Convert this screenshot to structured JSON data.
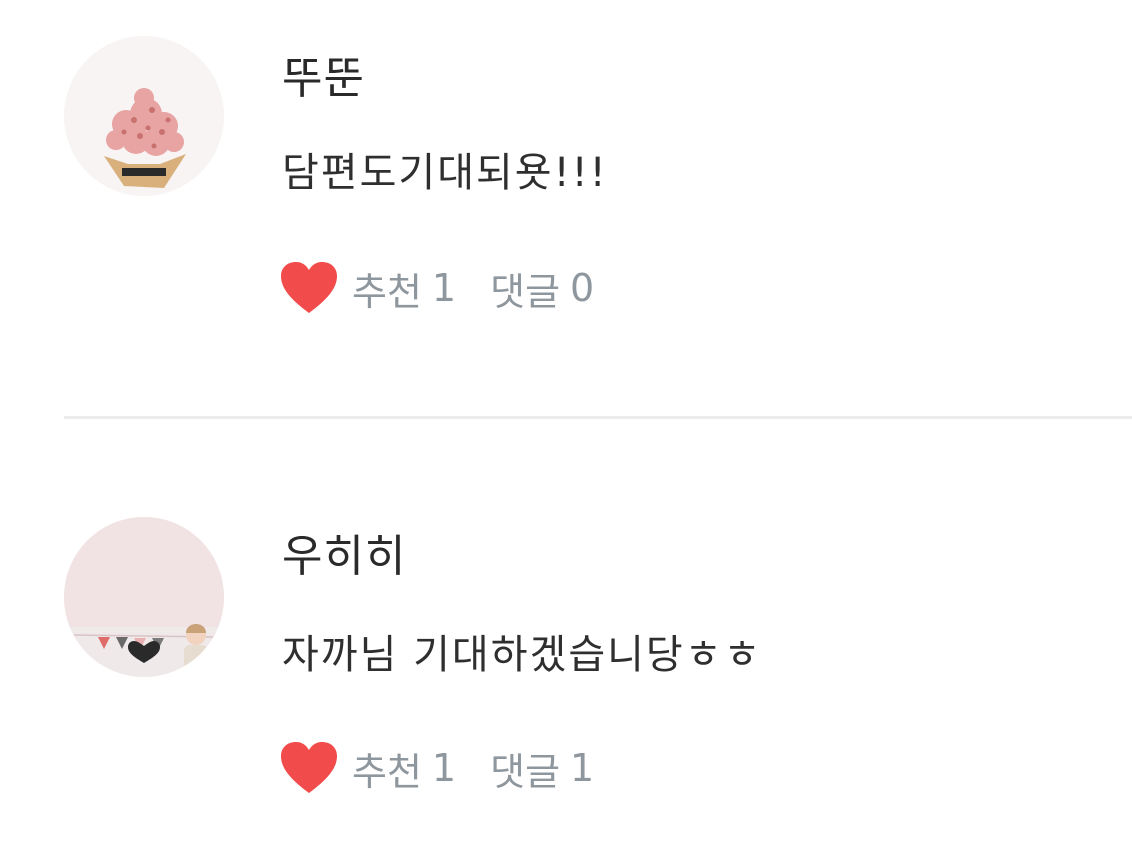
{
  "comments": [
    {
      "username": "뚜뚠",
      "text": "담편도기대되욧!!!",
      "like_label": "추천",
      "like_count": "1",
      "reply_label": "댓글",
      "reply_count": "0"
    },
    {
      "username": "우히히",
      "text": "자까님 기대하겠습니당ㅎㅎ",
      "like_label": "추천",
      "like_count": "1",
      "reply_label": "댓글",
      "reply_count": "1"
    }
  ],
  "colors": {
    "heart": "#f24b4b",
    "meta_text": "#8f979e",
    "divider": "#ececec"
  },
  "icons": [
    "avatar",
    "heart-icon"
  ]
}
